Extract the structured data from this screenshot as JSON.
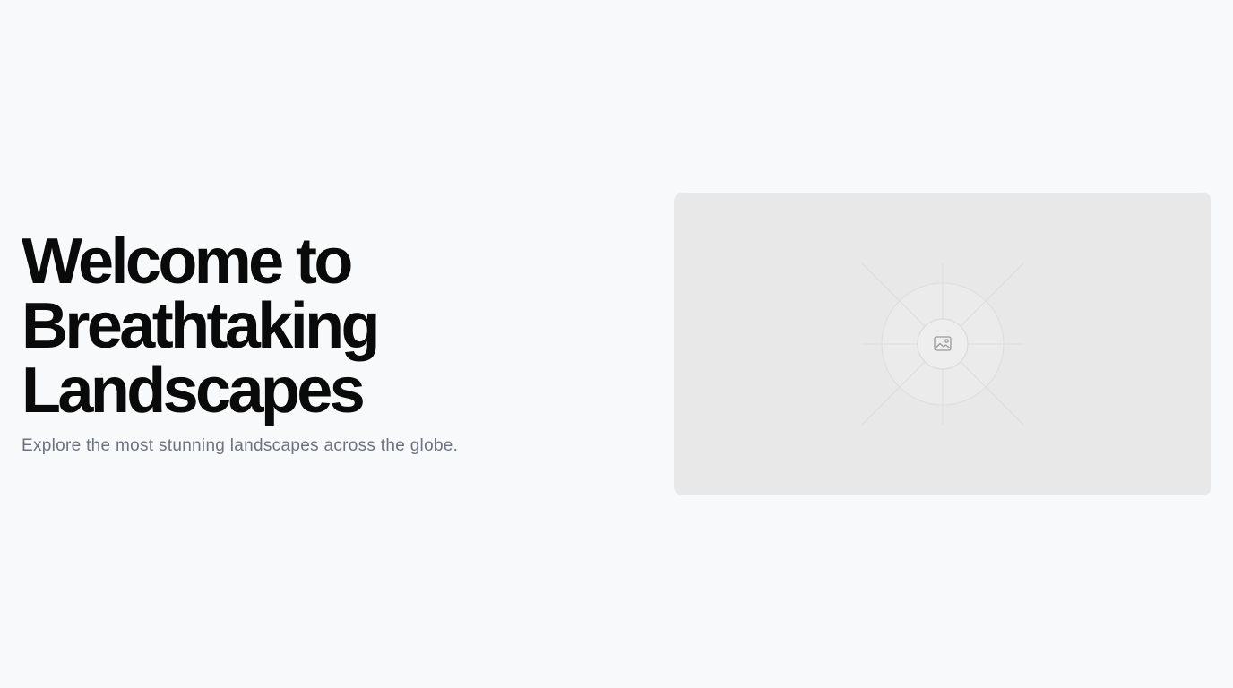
{
  "hero": {
    "title_lines": [
      "Welcome to",
      "Breathtaking",
      "Landscapes"
    ],
    "subtitle": "Explore the most stunning landscapes across the globe.",
    "image": {
      "icon": "image-icon",
      "background_color": "#e8e8e8"
    }
  },
  "colors": {
    "page_background": "#f8f9fb",
    "title": "#0a0a0a",
    "subtitle": "#6b7280"
  }
}
